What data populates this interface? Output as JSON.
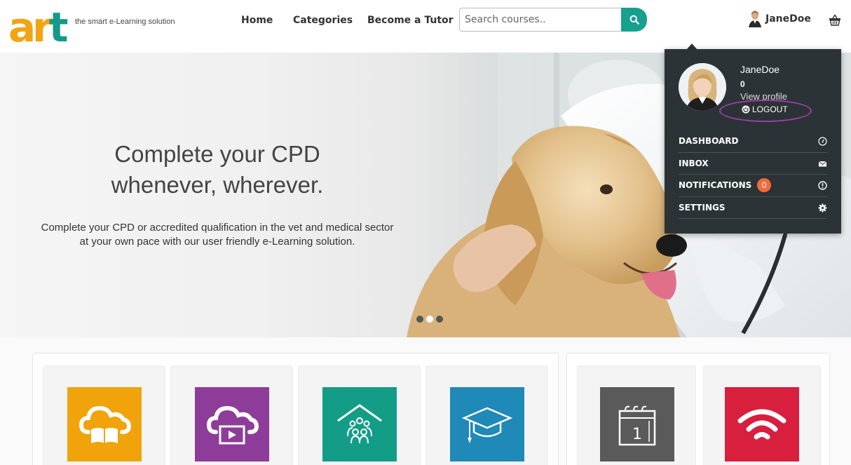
{
  "brand": {
    "logo_text": "art",
    "tagline": "the smart e-Learning solution",
    "colors": {
      "orange": "#f2a413",
      "teal": "#15998a"
    }
  },
  "nav": {
    "items": [
      {
        "label": "Home"
      },
      {
        "label": "Categories"
      },
      {
        "label": "Become a Tutor"
      }
    ]
  },
  "search": {
    "placeholder": "Search courses..",
    "button_icon": "search-icon",
    "button_color": "#17a08d"
  },
  "user": {
    "name": "JaneDoe",
    "cart_icon": "basket-icon"
  },
  "hero": {
    "title_line1": "Complete your CPD",
    "title_line2": "whenever, wherever.",
    "subtitle_line1": "Complete your CPD or accredited qualification in the vet and medical sector",
    "subtitle_line2": "at your own pace with our user friendly e-Learning solution.",
    "slides": 3,
    "active_slide": 2
  },
  "dropdown": {
    "name": "JaneDoe",
    "count": "0",
    "view_profile": "View profile",
    "logout": "LOGOUT",
    "menu": [
      {
        "label": "DASHBOARD",
        "icon": "dashboard-icon"
      },
      {
        "label": "INBOX",
        "icon": "envelope-icon"
      },
      {
        "label": "NOTIFICATIONS",
        "icon": "alert-icon",
        "badge": "0"
      },
      {
        "label": "SETTINGS",
        "icon": "gear-icon"
      }
    ],
    "highlight_color": "#9b3fa6",
    "badge_color": "#f26b3a"
  },
  "categories": [
    {
      "icon": "cloud-book-icon",
      "color": "#f0a30a"
    },
    {
      "icon": "cloud-video-icon",
      "color": "#8e3c99"
    },
    {
      "icon": "group-house-icon",
      "color": "#139d87"
    },
    {
      "icon": "graduation-cap-icon",
      "color": "#1f89b8"
    },
    {
      "icon": "calendar-icon",
      "color": "#5a5a5a"
    },
    {
      "icon": "wifi-icon",
      "color": "#d81f3e"
    }
  ]
}
